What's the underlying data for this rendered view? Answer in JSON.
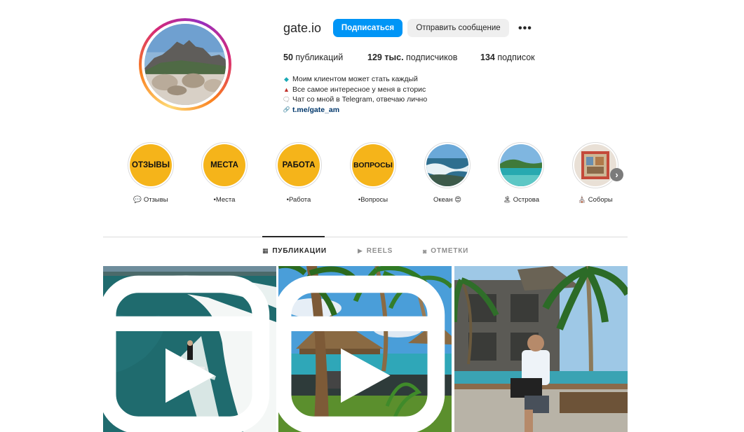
{
  "profile": {
    "username": "gate.io",
    "follow_label": "Подписаться",
    "message_label": "Отправить сообщение",
    "more_label": "•••",
    "stats": {
      "posts_count": "50",
      "posts_label": " публикаций",
      "followers_count": "129 тыс.",
      "followers_label": " подписчиков",
      "following_count": "134",
      "following_label": " подписок"
    },
    "bio": {
      "line1_mark": "◆",
      "line1": "Моим клиентом может стать каждый",
      "line2_mark": "▲",
      "line2": "Все самое интересное у меня в сторис",
      "line3_mark": "🗨",
      "line3": "Чат со мной в Telegram, отвечаю лично",
      "link_icon": "🔗",
      "link": "t.me/gate_am"
    }
  },
  "highlights": [
    {
      "cover_text": "ОТЗЫВЫ",
      "label": "💬 Отзывы",
      "kind": "yellow"
    },
    {
      "cover_text": "МЕСТА",
      "label": "•Места",
      "kind": "yellow"
    },
    {
      "cover_text": "РАБОТА",
      "label": "•Работа",
      "kind": "yellow"
    },
    {
      "cover_text": "ВОПРОСЫ",
      "label": "•Вопросы",
      "kind": "yellow"
    },
    {
      "cover_text": "",
      "label": "Океан 😍",
      "kind": "photo-ocean"
    },
    {
      "cover_text": "",
      "label": "🏝 Острова",
      "kind": "photo-island"
    },
    {
      "cover_text": "",
      "label": "⛪ Соборы",
      "kind": "photo-church"
    }
  ],
  "highlights_next_icon": "›",
  "tabs": [
    {
      "icon": "▦",
      "label": "ПУБЛИКАЦИИ",
      "active": true
    },
    {
      "icon": "▶",
      "label": "REELS",
      "active": false
    },
    {
      "icon": "◙",
      "label": "ОТМЕТКИ",
      "active": false
    }
  ],
  "posts": [
    {
      "subject": "surfer riding a wave",
      "reel": true
    },
    {
      "subject": "palm trees and beach umbrellas",
      "reel": true
    },
    {
      "subject": "man with laptop by pool",
      "reel": false
    }
  ],
  "colors": {
    "follow_button": "#0095f6",
    "highlight_yellow": "#f5b41a",
    "link": "#00376b"
  }
}
